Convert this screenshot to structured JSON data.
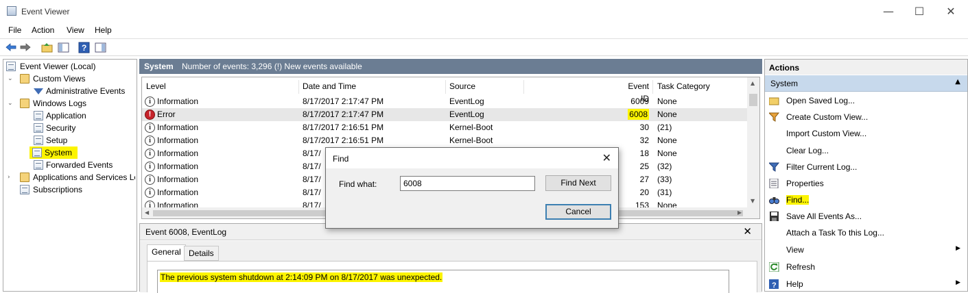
{
  "window": {
    "title": "Event Viewer",
    "minimize": "—",
    "maximize": "☐",
    "close": "✕"
  },
  "menu": [
    "File",
    "Action",
    "View",
    "Help"
  ],
  "tree": {
    "root": "Event Viewer (Local)",
    "custom_views": "Custom Views",
    "administrative_events": "Administrative Events",
    "windows_logs": "Windows Logs",
    "application": "Application",
    "security": "Security",
    "setup": "Setup",
    "system": "System",
    "forwarded_events": "Forwarded Events",
    "apps_services": "Applications and Services Lo",
    "subscriptions": "Subscriptions"
  },
  "center": {
    "log_name": "System",
    "summary": "Number of events: 3,296 (!) New events available",
    "columns": [
      "Level",
      "Date and Time",
      "Source",
      "Event ID",
      "Task Category"
    ],
    "rows": [
      {
        "level": "Information",
        "date": "8/17/2017 2:17:47 PM",
        "source": "EventLog",
        "id": "6009",
        "category": "None"
      },
      {
        "level": "Error",
        "date": "8/17/2017 2:17:47 PM",
        "source": "EventLog",
        "id": "6008",
        "category": "None"
      },
      {
        "level": "Information",
        "date": "8/17/2017 2:16:51 PM",
        "source": "Kernel-Boot",
        "id": "30",
        "category": "(21)"
      },
      {
        "level": "Information",
        "date": "8/17/2017 2:16:51 PM",
        "source": "Kernel-Boot",
        "id": "32",
        "category": "None"
      },
      {
        "level": "Information",
        "date": "8/17/",
        "source": "",
        "id": "18",
        "category": "None"
      },
      {
        "level": "Information",
        "date": "8/17/",
        "source": "",
        "id": "25",
        "category": "(32)"
      },
      {
        "level": "Information",
        "date": "8/17/",
        "source": "",
        "id": "27",
        "category": "(33)"
      },
      {
        "level": "Information",
        "date": "8/17/",
        "source": "",
        "id": "20",
        "category": "(31)"
      },
      {
        "level": "Information",
        "date": "8/17/",
        "source": "",
        "id": "153",
        "category": "None"
      }
    ]
  },
  "details": {
    "title": "Event 6008, EventLog",
    "close": "✕",
    "tab_general": "General",
    "tab_details": "Details",
    "description": "The previous system shutdown at 2:14:09 PM on 8/17/2017 was unexpected."
  },
  "actions": {
    "header": "Actions",
    "section": "System",
    "items": [
      "Open Saved Log...",
      "Create Custom View...",
      "Import Custom View...",
      "Clear Log...",
      "Filter Current Log...",
      "Properties",
      "Find...",
      "Save All Events As...",
      "Attach a Task To this Log...",
      "View",
      "Refresh",
      "Help"
    ]
  },
  "find_dialog": {
    "title": "Find",
    "label": "Find what:",
    "value": "6008",
    "find_next": "Find Next",
    "cancel": "Cancel"
  },
  "colors": {
    "highlight": "#fcf400",
    "header_bg": "#6b7d93",
    "section_bg": "#c7d9ec",
    "error_red": "#c6232b"
  }
}
